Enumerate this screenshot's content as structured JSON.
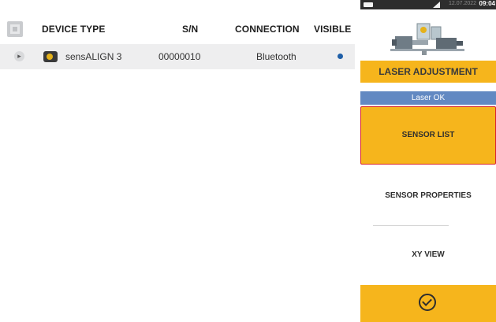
{
  "table": {
    "headers": {
      "device_type": "DEVICE TYPE",
      "sn": "S/N",
      "connection": "CONNECTION",
      "visible": "VISIBLE"
    },
    "rows": [
      {
        "device_type": "sensALIGN 3",
        "sn": "00000010",
        "connection": "Bluetooth",
        "visible": true,
        "icon": "sensor-icon"
      }
    ]
  },
  "statusbar": {
    "date_time": "12.07.2022",
    "time": "09:04"
  },
  "panel": {
    "laser_adjustment": "LASER ADJUSTMENT",
    "laser_status": "Laser OK",
    "sensor_list": "SENSOR LIST",
    "sensor_properties": "SENSOR PROPERTIES",
    "xy_view": "XY VIEW",
    "confirm_icon": "check-circle-icon"
  },
  "colors": {
    "accent": "#f6b51c",
    "laser_ok_bg": "#6289c2",
    "selected_border": "#d8232a",
    "visible_dot": "#1f5fa8"
  }
}
